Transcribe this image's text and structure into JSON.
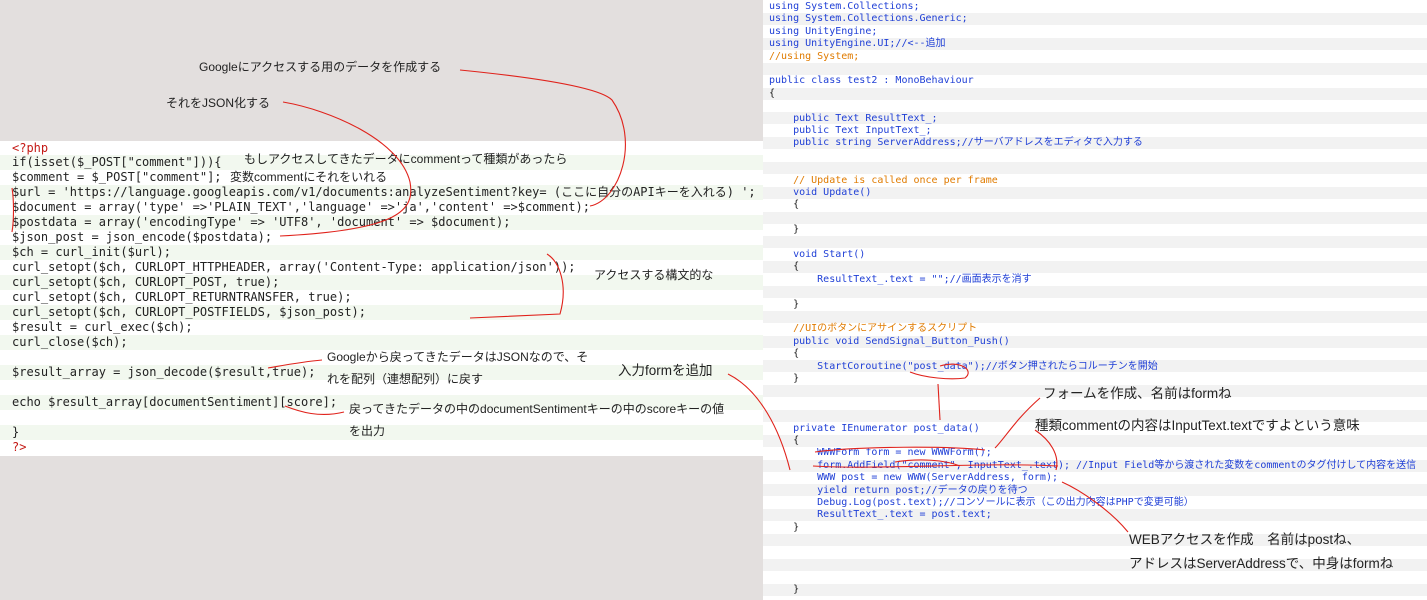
{
  "php": {
    "lines": [
      "<?php",
      "if(isset($_POST[\"comment\"])){",
      "$comment = $_POST[\"comment\"];",
      "$url = 'https://language.googleapis.com/v1/documents:analyzeSentiment?key= (ここに自分のAPIキーを入れる) ';",
      "$document = array('type' =>'PLAIN_TEXT','language' =>'ja','content' =>$comment);",
      "$postdata = array('encodingType' => 'UTF8', 'document' => $document);",
      "$json_post = json_encode($postdata);",
      "$ch = curl_init($url);",
      "curl_setopt($ch, CURLOPT_HTTPHEADER, array('Content-Type: application/json'));",
      "curl_setopt($ch, CURLOPT_POST, true);",
      "curl_setopt($ch, CURLOPT_RETURNTRANSFER, true);",
      "curl_setopt($ch, CURLOPT_POSTFIELDS, $json_post);",
      "$result = curl_exec($ch);",
      "curl_close($ch);",
      "",
      "$result_array = json_decode($result,true);",
      "",
      "echo $result_array[documentSentiment][score];",
      "",
      "}",
      "?>"
    ]
  },
  "php_notes": {
    "google_data": "Googleにアクセスする用のデータを作成する",
    "to_json": "それをJSON化する",
    "if_comment": "もしアクセスしてきたデータにcommentって種類があったら",
    "var_comment": "変数commentにそれをいれる",
    "syntax": "アクセスする構文的な",
    "json_returned": "Googleから戻ってきたデータはJSONなので、それを配列（連想配列）に戻す",
    "output_score": "戻ってきたデータの中のdocumentSentimentキーの中のscoreキーの値を出力"
  },
  "csharp": {
    "lines": [
      "using System.Collections;",
      "using System.Collections.Generic;",
      "using UnityEngine;",
      "using UnityEngine.UI;//<--追加",
      "//using System;",
      "",
      "public class test2 : MonoBehaviour",
      "{",
      "",
      "    public Text ResultText_;",
      "    public Text InputText_;",
      "    public string ServerAddress;//サーバアドレスをエディタで入力する",
      "",
      "",
      "    // Update is called once per frame",
      "    void Update()",
      "    {",
      "",
      "    }",
      "",
      "    void Start()",
      "    {",
      "        ResultText_.text = \"\";//画面表示を消す",
      "",
      "    }",
      "",
      "    //UIのボタンにアサインするスクリプト",
      "    public void SendSignal_Button_Push()",
      "    {",
      "        StartCoroutine(\"post_data\");//ボタン押されたらコルーチンを開始",
      "    }",
      "",
      "",
      "",
      "    private IEnumerator post_data()",
      "    {",
      "        WWWForm form = new WWWForm();",
      "        form.AddField(\"comment\", InputText_.text); //Input Field等から渡された変数をcommentのタグ付けして内容を送信",
      "        WWW post = new WWW(ServerAddress, form);",
      "        yield return post;//データの戻りを待つ",
      "        Debug.Log(post.text);//コンソールに表示（この出力内容はPHPで変更可能）",
      "        ResultText_.text = post.text;",
      "    }",
      "",
      "",
      "",
      "",
      "",
      "    }"
    ]
  },
  "csharp_notes": {
    "add_form": "入力formを追加",
    "form_name": "フォームを作成、名前はformね",
    "comment_kind": "種類commentの内容はInputText.textですよという意味",
    "www_access_1": "WEBアクセスを作成　名前はpostね、",
    "www_access_2": "アドレスはServerAddressで、中身はformね"
  },
  "colors": {
    "left_background": "#e3dfde",
    "annotation_red": "#e0221b",
    "keyword_blue": "#0d3c9c",
    "string_green": "#1a7a14",
    "comment_orange": "#e07b00"
  }
}
